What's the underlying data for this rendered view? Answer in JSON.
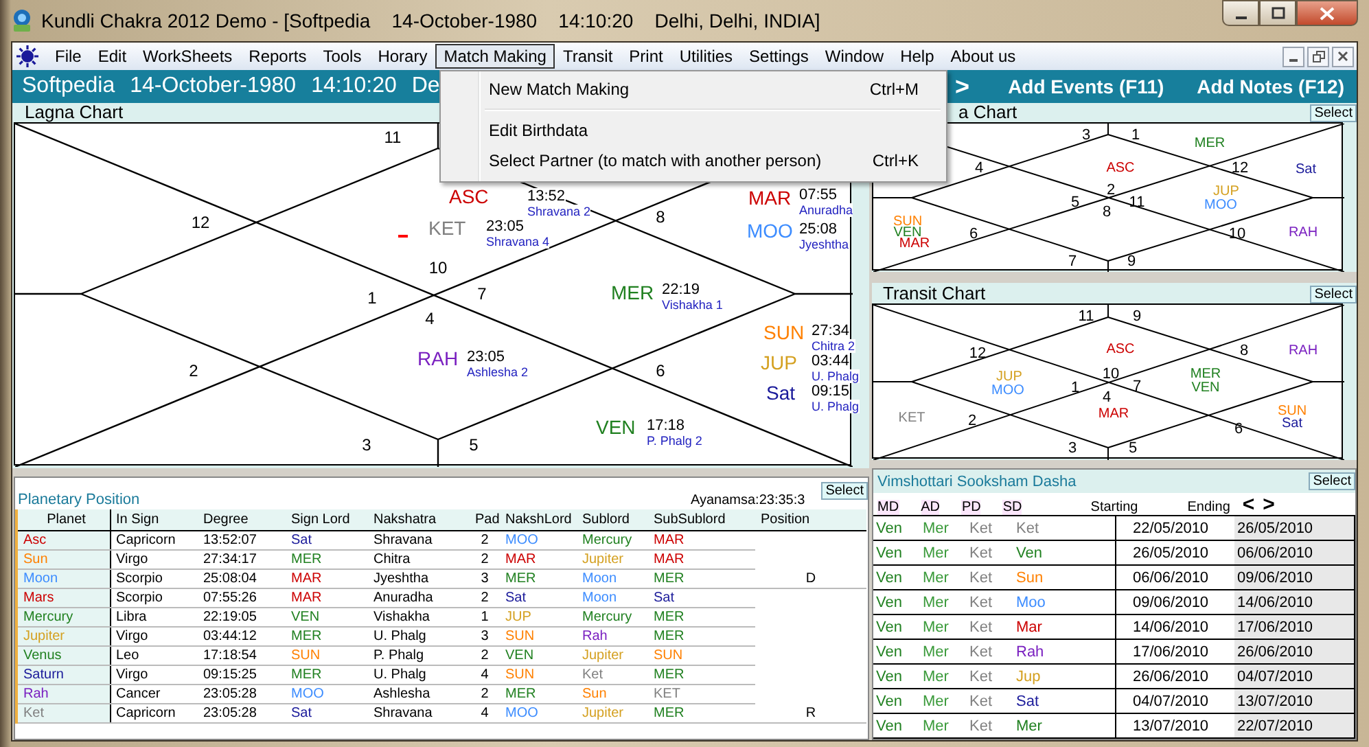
{
  "window": {
    "title": "Kundli Chakra 2012 Demo - [Softpedia    14-October-1980    14:10:20    Delhi, Delhi, INDIA]"
  },
  "menu": [
    {
      "label": "File",
      "selected": false
    },
    {
      "label": "Edit",
      "selected": false
    },
    {
      "label": "WorkSheets",
      "selected": false
    },
    {
      "label": "Reports",
      "selected": false
    },
    {
      "label": "Tools",
      "selected": false
    },
    {
      "label": "Horary",
      "selected": false
    },
    {
      "label": "Match Making",
      "selected": true
    },
    {
      "label": "Transit",
      "selected": false
    },
    {
      "label": "Print",
      "selected": false
    },
    {
      "label": "Utilities",
      "selected": false
    },
    {
      "label": "Settings",
      "selected": false
    },
    {
      "label": "Window",
      "selected": false
    },
    {
      "label": "Help",
      "selected": false
    },
    {
      "label": "About us",
      "selected": false
    }
  ],
  "open_menu": {
    "items": [
      {
        "kind": "item",
        "label": "New Match Making",
        "shortcut": "Ctrl+M"
      },
      {
        "kind": "separator"
      },
      {
        "kind": "item",
        "label": "Edit Birthdata"
      },
      {
        "kind": "item",
        "label": "Select Partner  (to match with another person)",
        "shortcut": "Ctrl+K"
      }
    ]
  },
  "header": {
    "fields": [
      "Softpedia",
      "14-October-1980",
      "14:10:20",
      "De"
    ],
    "next": ">",
    "actions": [
      "Add Events (F11)",
      "Add Notes (F12)"
    ]
  },
  "charts": [
    {
      "title": "Lagna Chart",
      "signs": [
        "11",
        "12",
        "10",
        "8",
        "1",
        "7",
        "4",
        "2",
        "6",
        "3",
        "5"
      ],
      "planets": [
        {
          "abbr": "ASC",
          "color": "#cc0000",
          "time": "13:52",
          "nakshatra": "Shravana 2",
          "marked": false
        },
        {
          "abbr": "KET",
          "color": "#808080",
          "time": "23:05",
          "nakshatra": "Shravana 4",
          "marked": true
        },
        {
          "abbr": "MAR",
          "color": "#cc0000",
          "time": "07:55",
          "nakshatra": "Anuradha",
          "marked": false
        },
        {
          "abbr": "MOO",
          "color": "#3c8cff",
          "time": "25:08",
          "nakshatra": "Jyeshtha",
          "marked": false
        },
        {
          "abbr": "MER",
          "color": "#208020",
          "time": "22:19",
          "nakshatra": "Vishakha 1",
          "marked": false
        },
        {
          "abbr": "RAH",
          "color": "#7a20c0",
          "time": "23:05",
          "nakshatra": "Ashlesha 2",
          "marked": false
        },
        {
          "abbr": "SUN",
          "color": "#ff8000",
          "time": "27:34",
          "nakshatra": "Chitra 2",
          "marked": false
        },
        {
          "abbr": "JUP",
          "color": "#d4a020",
          "time": "03:44",
          "nakshatra": "U. Phalg",
          "marked": false
        },
        {
          "abbr": "Sat",
          "color": "#1a1a9a",
          "time": "09:15",
          "nakshatra": "U. Phalg",
          "marked": false
        },
        {
          "abbr": "VEN",
          "color": "#208020",
          "time": "17:18",
          "nakshatra": "P. Phalg 2",
          "marked": false
        }
      ]
    },
    {
      "title": "a Chart",
      "select": "Select",
      "signs": [
        "3",
        "1",
        "4",
        "12",
        "2",
        "5",
        "11",
        "8",
        "6",
        "10",
        "7",
        "9"
      ],
      "planets": [
        {
          "abbr": "MER",
          "color": "#208020"
        },
        {
          "abbr": "ASC",
          "color": "#cc0000"
        },
        {
          "abbr": "Sat",
          "color": "#1a1a9a"
        },
        {
          "abbr": "JUP",
          "color": "#d4a020"
        },
        {
          "abbr": "MOO",
          "color": "#3c8cff"
        },
        {
          "abbr": "SUN",
          "color": "#ff8000"
        },
        {
          "abbr": "VEN",
          "color": "#208020"
        },
        {
          "abbr": "MAR",
          "color": "#cc0000"
        },
        {
          "abbr": "RAH",
          "color": "#7a20c0"
        }
      ]
    },
    {
      "title": "Transit Chart",
      "select": "Select",
      "signs": [
        "11",
        "9",
        "12",
        "8",
        "10",
        "1",
        "7",
        "4",
        "2",
        "6",
        "3",
        "5"
      ],
      "planets": [
        {
          "abbr": "ASC",
          "color": "#cc0000"
        },
        {
          "abbr": "RAH",
          "color": "#7a20c0"
        },
        {
          "abbr": "JUP",
          "color": "#d4a020"
        },
        {
          "abbr": "MOO",
          "color": "#3c8cff"
        },
        {
          "abbr": "MER",
          "color": "#208020"
        },
        {
          "abbr": "VEN",
          "color": "#208020"
        },
        {
          "abbr": "KET",
          "color": "#808080"
        },
        {
          "abbr": "MAR",
          "color": "#cc0000"
        },
        {
          "abbr": "SUN",
          "color": "#ff8000"
        },
        {
          "abbr": "Sat",
          "color": "#1a1a9a"
        }
      ]
    }
  ],
  "planetary_position": {
    "title": "Planetary Position",
    "ayanamsa": "Ayanamsa:23:35:3",
    "select": "Select",
    "columns": [
      "Planet",
      "In Sign",
      "Degree",
      "Sign Lord",
      "Nakshatra",
      "Pad",
      "NakshLord",
      "Sublord",
      "SubSublord",
      "Position"
    ],
    "rows": [
      {
        "cells": [
          {
            "text": "Asc",
            "color": "#cc0000"
          },
          {
            "text": "Capricorn"
          },
          {
            "text": "13:52:07"
          },
          {
            "text": "Sat",
            "color": "#1a1a9a"
          },
          {
            "text": "Shravana"
          },
          {
            "text": "2"
          },
          {
            "text": "MOO",
            "color": "#3c8cff"
          },
          {
            "text": "Mercury",
            "color": "#208020"
          },
          {
            "text": "MAR",
            "color": "#cc0000"
          }
        ]
      },
      {
        "cells": [
          {
            "text": "Sun",
            "color": "#ff8000"
          },
          {
            "text": "Virgo"
          },
          {
            "text": "27:34:17"
          },
          {
            "text": "MER",
            "color": "#208020"
          },
          {
            "text": "Chitra"
          },
          {
            "text": "2"
          },
          {
            "text": "MAR",
            "color": "#cc0000"
          },
          {
            "text": "Jupiter",
            "color": "#d4a020"
          },
          {
            "text": "MAR",
            "color": "#cc0000"
          }
        ]
      },
      {
        "cells": [
          {
            "text": "Moon",
            "color": "#3c8cff"
          },
          {
            "text": "Scorpio"
          },
          {
            "text": "25:08:04"
          },
          {
            "text": "MAR",
            "color": "#cc0000"
          },
          {
            "text": "Jyeshtha"
          },
          {
            "text": "3"
          },
          {
            "text": "MER",
            "color": "#208020"
          },
          {
            "text": "Moon",
            "color": "#3c8cff"
          },
          {
            "text": "MER",
            "color": "#208020"
          },
          {
            "text": "D"
          }
        ]
      },
      {
        "cells": [
          {
            "text": "Mars",
            "color": "#cc0000"
          },
          {
            "text": "Scorpio"
          },
          {
            "text": "07:55:26"
          },
          {
            "text": "MAR",
            "color": "#cc0000"
          },
          {
            "text": "Anuradha"
          },
          {
            "text": "2"
          },
          {
            "text": "Sat",
            "color": "#1a1a9a"
          },
          {
            "text": "Moon",
            "color": "#3c8cff"
          },
          {
            "text": "Sat",
            "color": "#1a1a9a"
          }
        ]
      },
      {
        "cells": [
          {
            "text": "Mercury",
            "color": "#208020"
          },
          {
            "text": "Libra"
          },
          {
            "text": "22:19:05"
          },
          {
            "text": "VEN",
            "color": "#208020"
          },
          {
            "text": "Vishakha"
          },
          {
            "text": "1"
          },
          {
            "text": "JUP",
            "color": "#d4a020"
          },
          {
            "text": "Mercury",
            "color": "#208020"
          },
          {
            "text": "MER",
            "color": "#208020"
          }
        ]
      },
      {
        "cells": [
          {
            "text": "Jupiter",
            "color": "#d4a020"
          },
          {
            "text": "Virgo"
          },
          {
            "text": "03:44:12"
          },
          {
            "text": "MER",
            "color": "#208020"
          },
          {
            "text": "U. Phalg"
          },
          {
            "text": "3"
          },
          {
            "text": "SUN",
            "color": "#ff8000"
          },
          {
            "text": "Rah",
            "color": "#7a20c0"
          },
          {
            "text": "MER",
            "color": "#208020"
          }
        ]
      },
      {
        "cells": [
          {
            "text": "Venus",
            "color": "#208020"
          },
          {
            "text": "Leo"
          },
          {
            "text": "17:18:54"
          },
          {
            "text": "SUN",
            "color": "#ff8000"
          },
          {
            "text": "P. Phalg"
          },
          {
            "text": "2"
          },
          {
            "text": "VEN",
            "color": "#208020"
          },
          {
            "text": "Jupiter",
            "color": "#d4a020"
          },
          {
            "text": "SUN",
            "color": "#ff8000"
          }
        ]
      },
      {
        "cells": [
          {
            "text": "Saturn",
            "color": "#1a1a9a"
          },
          {
            "text": "Virgo"
          },
          {
            "text": "09:15:25"
          },
          {
            "text": "MER",
            "color": "#208020"
          },
          {
            "text": "U. Phalg"
          },
          {
            "text": "4"
          },
          {
            "text": "SUN",
            "color": "#ff8000"
          },
          {
            "text": "Ket",
            "color": "#808080"
          },
          {
            "text": "MER",
            "color": "#208020"
          }
        ]
      },
      {
        "cells": [
          {
            "text": "Rah",
            "color": "#7a20c0"
          },
          {
            "text": "Cancer"
          },
          {
            "text": "23:05:28"
          },
          {
            "text": "MOO",
            "color": "#3c8cff"
          },
          {
            "text": "Ashlesha"
          },
          {
            "text": "2"
          },
          {
            "text": "MER",
            "color": "#208020"
          },
          {
            "text": "Sun",
            "color": "#ff8000"
          },
          {
            "text": "KET",
            "color": "#808080"
          }
        ]
      },
      {
        "cells": [
          {
            "text": "Ket",
            "color": "#808080"
          },
          {
            "text": "Capricorn"
          },
          {
            "text": "23:05:28"
          },
          {
            "text": "Sat",
            "color": "#1a1a9a"
          },
          {
            "text": "Shravana"
          },
          {
            "text": "4"
          },
          {
            "text": "MOO",
            "color": "#3c8cff"
          },
          {
            "text": "Jupiter",
            "color": "#d4a020"
          },
          {
            "text": "MER",
            "color": "#208020"
          },
          {
            "text": "R"
          }
        ]
      }
    ]
  },
  "dasha": {
    "title": "Vimshottari Sooksham Dasha",
    "select": "Select",
    "prev": "<",
    "next": ">",
    "columns": [
      "MD",
      "AD",
      "PD",
      "SD",
      "Starting",
      "Ending"
    ],
    "rows": [
      {
        "cells": [
          {
            "text": "Ven",
            "color": "#208020"
          },
          {
            "text": "Mer",
            "color": "#3a9a3a"
          },
          {
            "text": "Ket",
            "color": "#808080"
          },
          {
            "text": "Ket",
            "color": "#808080"
          },
          {
            "text": "22/05/2010"
          },
          {
            "text": "26/05/2010"
          }
        ]
      },
      {
        "cells": [
          {
            "text": "Ven",
            "color": "#208020"
          },
          {
            "text": "Mer",
            "color": "#3a9a3a"
          },
          {
            "text": "Ket",
            "color": "#808080"
          },
          {
            "text": "Ven",
            "color": "#208020"
          },
          {
            "text": "26/05/2010"
          },
          {
            "text": "06/06/2010"
          }
        ]
      },
      {
        "cells": [
          {
            "text": "Ven",
            "color": "#208020"
          },
          {
            "text": "Mer",
            "color": "#3a9a3a"
          },
          {
            "text": "Ket",
            "color": "#808080"
          },
          {
            "text": "Sun",
            "color": "#ff8000"
          },
          {
            "text": "06/06/2010"
          },
          {
            "text": "09/06/2010"
          }
        ]
      },
      {
        "cells": [
          {
            "text": "Ven",
            "color": "#208020"
          },
          {
            "text": "Mer",
            "color": "#3a9a3a"
          },
          {
            "text": "Ket",
            "color": "#808080"
          },
          {
            "text": "Moo",
            "color": "#3c8cff"
          },
          {
            "text": "09/06/2010"
          },
          {
            "text": "14/06/2010"
          }
        ]
      },
      {
        "cells": [
          {
            "text": "Ven",
            "color": "#208020"
          },
          {
            "text": "Mer",
            "color": "#3a9a3a"
          },
          {
            "text": "Ket",
            "color": "#808080"
          },
          {
            "text": "Mar",
            "color": "#cc0000"
          },
          {
            "text": "14/06/2010"
          },
          {
            "text": "17/06/2010"
          }
        ]
      },
      {
        "cells": [
          {
            "text": "Ven",
            "color": "#208020"
          },
          {
            "text": "Mer",
            "color": "#3a9a3a"
          },
          {
            "text": "Ket",
            "color": "#808080"
          },
          {
            "text": "Rah",
            "color": "#7a20c0"
          },
          {
            "text": "17/06/2010"
          },
          {
            "text": "26/06/2010"
          }
        ]
      },
      {
        "cells": [
          {
            "text": "Ven",
            "color": "#208020"
          },
          {
            "text": "Mer",
            "color": "#3a9a3a"
          },
          {
            "text": "Ket",
            "color": "#808080"
          },
          {
            "text": "Jup",
            "color": "#d4a020"
          },
          {
            "text": "26/06/2010"
          },
          {
            "text": "04/07/2010"
          }
        ]
      },
      {
        "cells": [
          {
            "text": "Ven",
            "color": "#208020"
          },
          {
            "text": "Mer",
            "color": "#3a9a3a"
          },
          {
            "text": "Ket",
            "color": "#808080"
          },
          {
            "text": "Sat",
            "color": "#1a1a9a"
          },
          {
            "text": "04/07/2010"
          },
          {
            "text": "13/07/2010"
          }
        ]
      },
      {
        "cells": [
          {
            "text": "Ven",
            "color": "#208020"
          },
          {
            "text": "Mer",
            "color": "#3a9a3a"
          },
          {
            "text": "Ket",
            "color": "#808080"
          },
          {
            "text": "Mer",
            "color": "#208020"
          },
          {
            "text": "13/07/2010"
          },
          {
            "text": "22/07/2010"
          }
        ]
      }
    ]
  }
}
